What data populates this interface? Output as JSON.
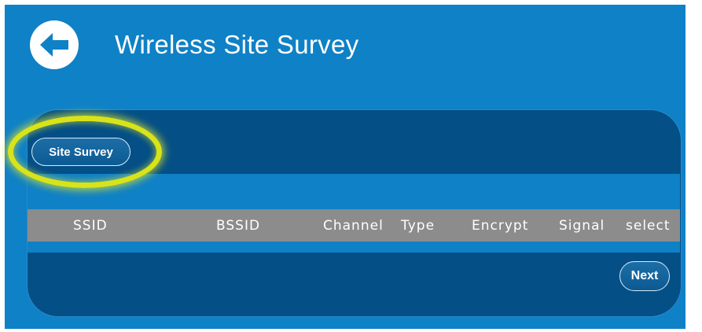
{
  "header": {
    "title": "Wireless Site Survey",
    "back_icon": "arrow-left-circle-icon"
  },
  "toolbar": {
    "site_survey_label": "Site Survey"
  },
  "table": {
    "columns": [
      "SSID",
      "BSSID",
      "Channel",
      "Type",
      "Encrypt",
      "Signal",
      "select"
    ],
    "rows": []
  },
  "footer": {
    "next_label": "Next"
  },
  "colors": {
    "background": "#0f81c6",
    "panel": "#044f86",
    "header_row": "#8c8c8c",
    "highlight": "#d8e31a"
  }
}
